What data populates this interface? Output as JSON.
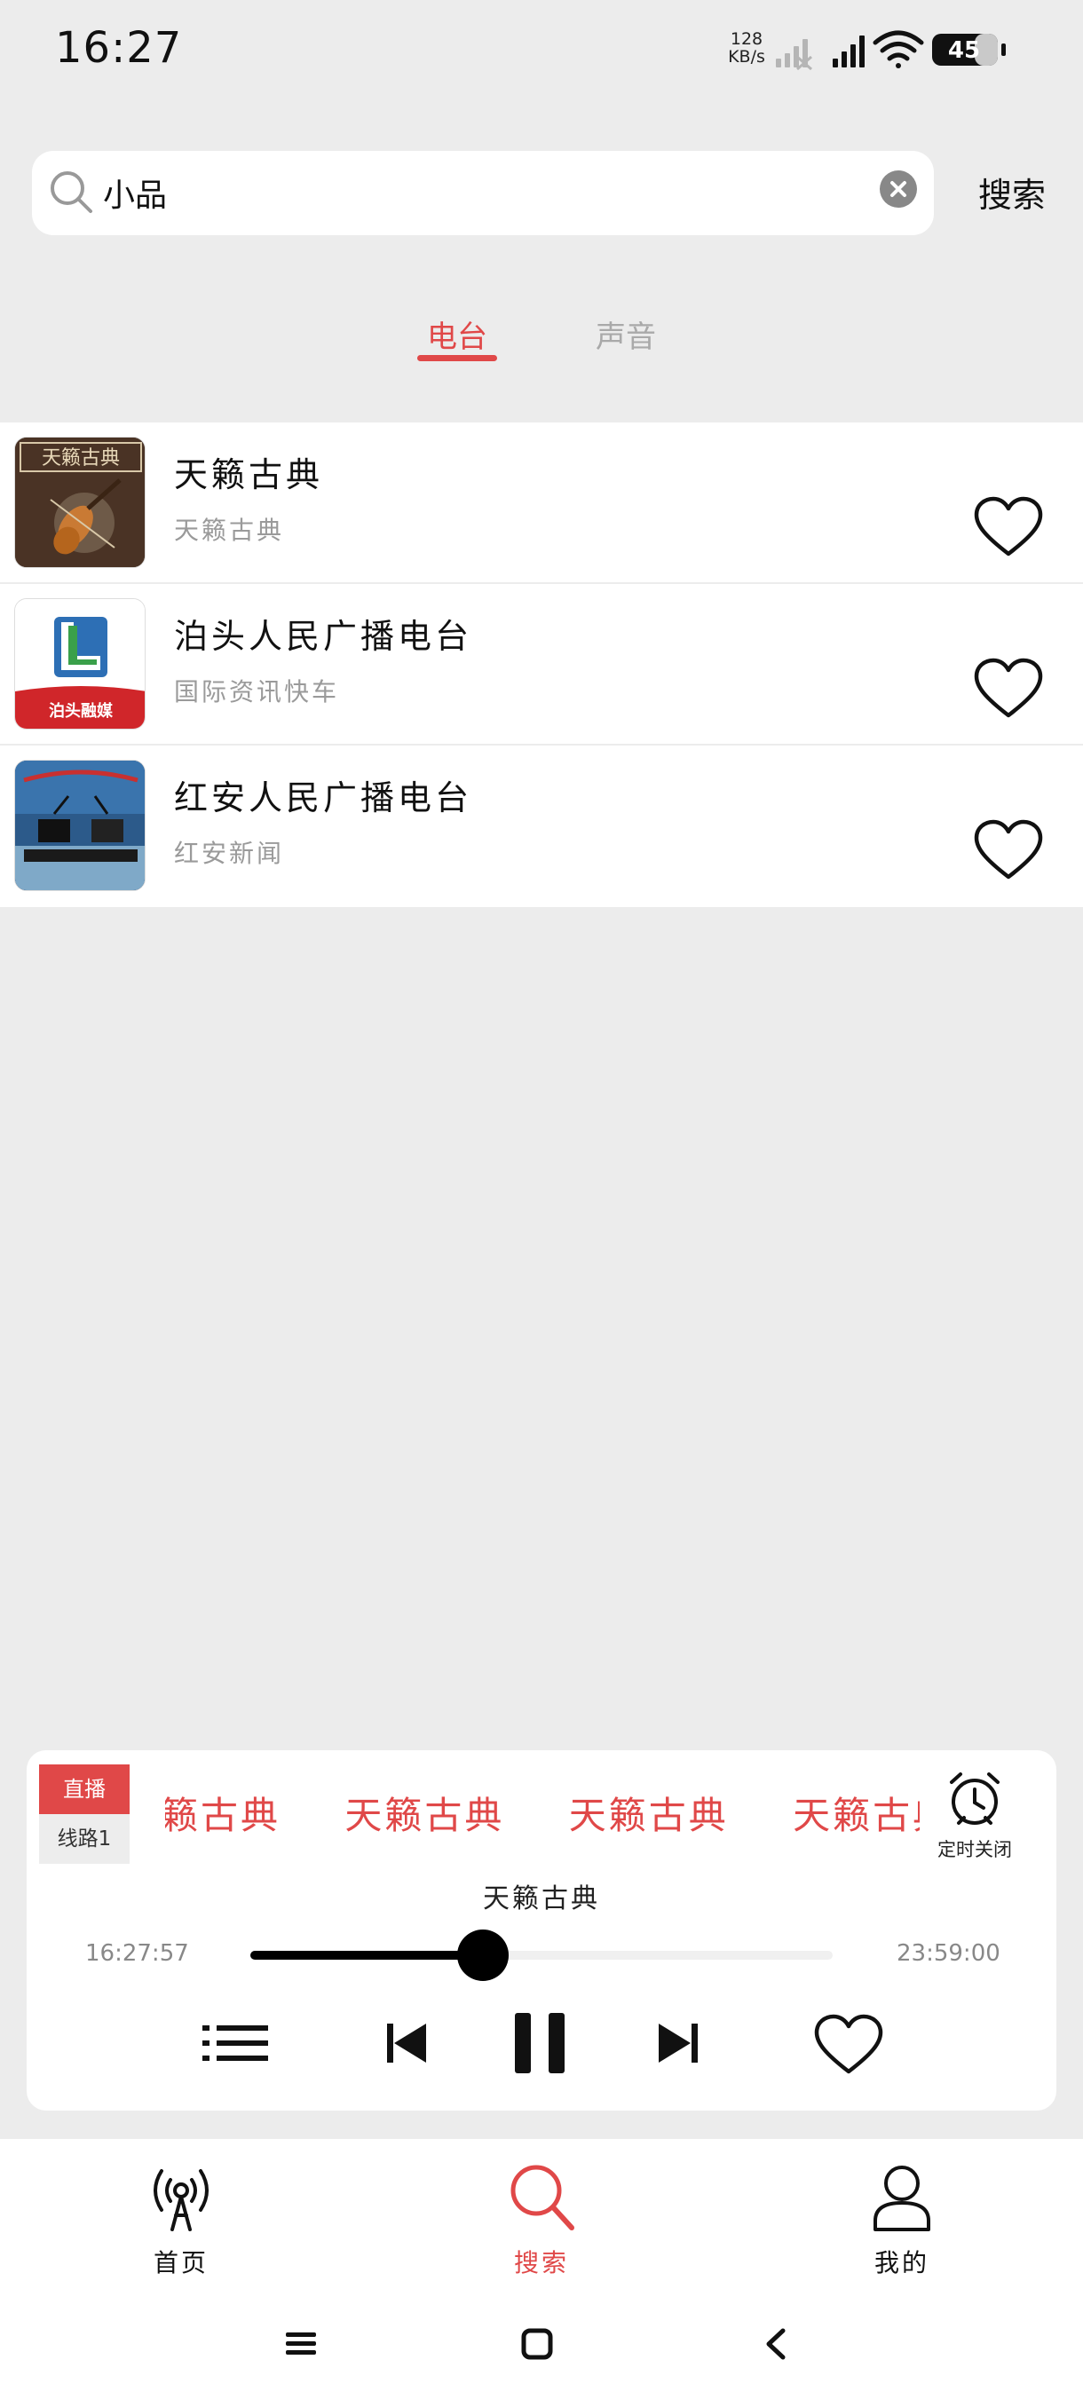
{
  "status_bar": {
    "time": "16:27",
    "net_speed_value": "128",
    "net_speed_unit": "KB/s",
    "battery": "45"
  },
  "search": {
    "query": "小品",
    "button_label": "搜索"
  },
  "tabs": [
    {
      "label": "电台",
      "active": true
    },
    {
      "label": "声音",
      "active": false
    }
  ],
  "results": [
    {
      "title": "天籁古典",
      "subtitle": "天籁古典",
      "thumb_text": "天籁古典",
      "favorited": false
    },
    {
      "title": "泊头人民广播电台",
      "subtitle": "国际资讯快车",
      "thumb_text": "泊头融媒",
      "favorited": false
    },
    {
      "title": "红安人民广播电台",
      "subtitle": "红安新闻",
      "favorited": false
    }
  ],
  "player": {
    "live_label": "直播",
    "line_label": "线路1",
    "marquee_text": "天籁古典",
    "timer_label": "定时关闭",
    "now_playing": "天籁古典",
    "start_time": "16:27:57",
    "end_time": "23:59:00",
    "progress": 0.4
  },
  "bottom_nav": [
    {
      "label": "首页",
      "icon": "radio-tower-icon",
      "active": false
    },
    {
      "label": "搜索",
      "icon": "search-icon",
      "active": true
    },
    {
      "label": "我的",
      "icon": "user-icon",
      "active": false
    }
  ],
  "colors": {
    "accent": "#e04848",
    "background": "#ececec",
    "muted_text": "#9a9a9a"
  }
}
